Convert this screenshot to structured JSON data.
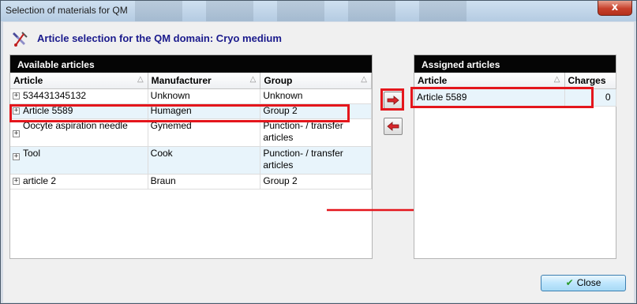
{
  "window": {
    "title": "Selection of materials for QM",
    "close_glyph": "x"
  },
  "header": {
    "icon": "qm-tools-icon",
    "title": "Article selection for the QM domain: Cryo medium"
  },
  "available": {
    "title": "Available articles",
    "columns": [
      "Article",
      "Manufacturer",
      "Group"
    ],
    "sort_glyph": "△",
    "expander_glyph": "+",
    "rows": [
      {
        "article": "534431345132",
        "manufacturer": "Unknown",
        "group": "Unknown"
      },
      {
        "article": "Article 5589",
        "manufacturer": "Humagen",
        "group": "Group 2"
      },
      {
        "article": "Oocyte aspiration needle",
        "manufacturer": "Gynemed",
        "group": "Punction- / transfer articles"
      },
      {
        "article": "Tool",
        "manufacturer": "Cook",
        "group": "Punction- / transfer articles"
      },
      {
        "article": "article 2",
        "manufacturer": "Braun",
        "group": "Group 2"
      }
    ]
  },
  "assigned": {
    "title": "Assigned articles",
    "columns": [
      "Article",
      "Charges"
    ],
    "rows": [
      {
        "article": "Article 5589",
        "charges": "0"
      }
    ]
  },
  "buttons": {
    "assign_icon": "arrow-right-icon",
    "remove_icon": "arrow-left-icon",
    "close_label": "Close",
    "close_icon": "checkmark-icon"
  },
  "colors": {
    "highlight": "#e4161c",
    "panel_header": "#050505",
    "header_title": "#1a1a8c"
  }
}
